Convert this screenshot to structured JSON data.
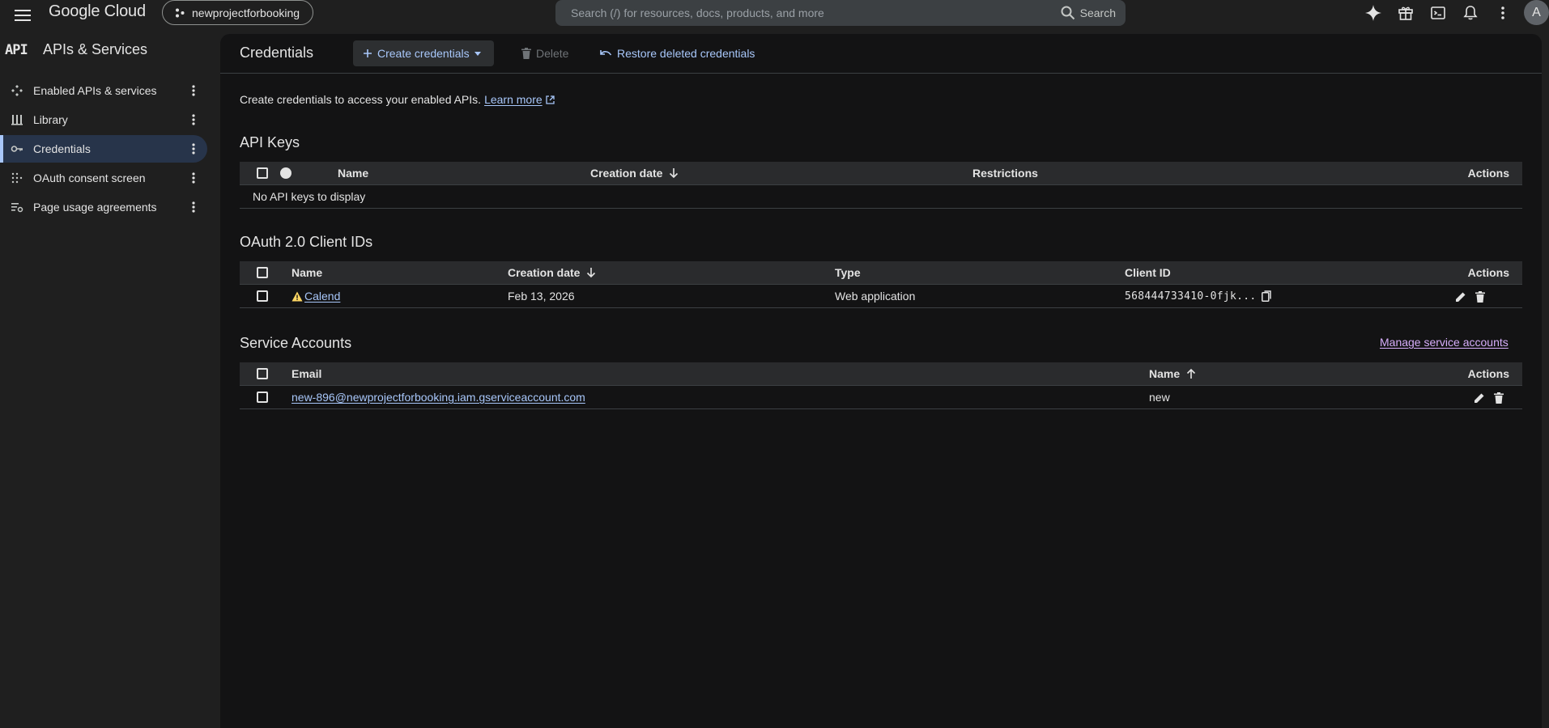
{
  "header": {
    "logo": "Google Cloud",
    "project": "newprojectforbooking",
    "search": {
      "placeholder": "Search (/) for resources, docs, products, and more",
      "button_label": "Search"
    },
    "avatar_initial": "A"
  },
  "sidebar": {
    "api_logo": "API",
    "title": "APIs & Services",
    "items": [
      {
        "label": "Enabled APIs & services",
        "icon": "enabled-apis-icon",
        "active": false
      },
      {
        "label": "Library",
        "icon": "library-icon",
        "active": false
      },
      {
        "label": "Credentials",
        "icon": "key-icon",
        "active": true
      },
      {
        "label": "OAuth consent screen",
        "icon": "oauth-consent-icon",
        "active": false
      },
      {
        "label": "Page usage agreements",
        "icon": "page-usage-icon",
        "active": false
      }
    ]
  },
  "toolbar": {
    "title": "Credentials",
    "create_label": "Create credentials",
    "delete_label": "Delete",
    "restore_label": "Restore deleted credentials"
  },
  "intro": {
    "text": "Create credentials to access your enabled APIs.",
    "link": "Learn more"
  },
  "api_keys": {
    "title": "API Keys",
    "columns": {
      "name": "Name",
      "creation_date": "Creation date",
      "restrictions": "Restrictions",
      "actions": "Actions"
    },
    "empty_text": "No API keys to display"
  },
  "oauth": {
    "title": "OAuth 2.0 Client IDs",
    "columns": {
      "name": "Name",
      "creation_date": "Creation date",
      "type": "Type",
      "client_id": "Client ID",
      "actions": "Actions"
    },
    "rows": [
      {
        "name": "Calend",
        "creation_date": "Feb 13, 2026",
        "type": "Web application",
        "client_id": "568444733410-0fjk..."
      }
    ]
  },
  "service_accounts": {
    "title": "Service Accounts",
    "manage_link": "Manage service accounts",
    "columns": {
      "email": "Email",
      "name": "Name",
      "actions": "Actions"
    },
    "rows": [
      {
        "email": "new-896@newprojectforbooking.iam.gserviceaccount.com",
        "name": "new"
      }
    ]
  },
  "colors": {
    "accent_link": "#a8c7fa",
    "visited_link": "#d7aefb",
    "warning": "#fdd663",
    "active_nav": "#27344a"
  }
}
